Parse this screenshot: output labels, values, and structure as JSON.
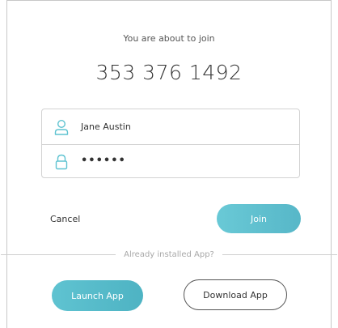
{
  "join_dialog": {
    "subtitle": "You are about to join",
    "meeting_id": "353 376 1492",
    "name_field": {
      "icon": "user-icon",
      "value": "Jane Austin"
    },
    "password_field": {
      "icon": "lock-icon",
      "value": "••••••"
    },
    "cancel_label": "Cancel",
    "join_label": "Join",
    "divider_label": "Already installed App?",
    "launch_label": "Launch App",
    "download_label": "Download App"
  },
  "colors": {
    "accent": "#5fc3d1",
    "icon": "#5fc3d1"
  }
}
